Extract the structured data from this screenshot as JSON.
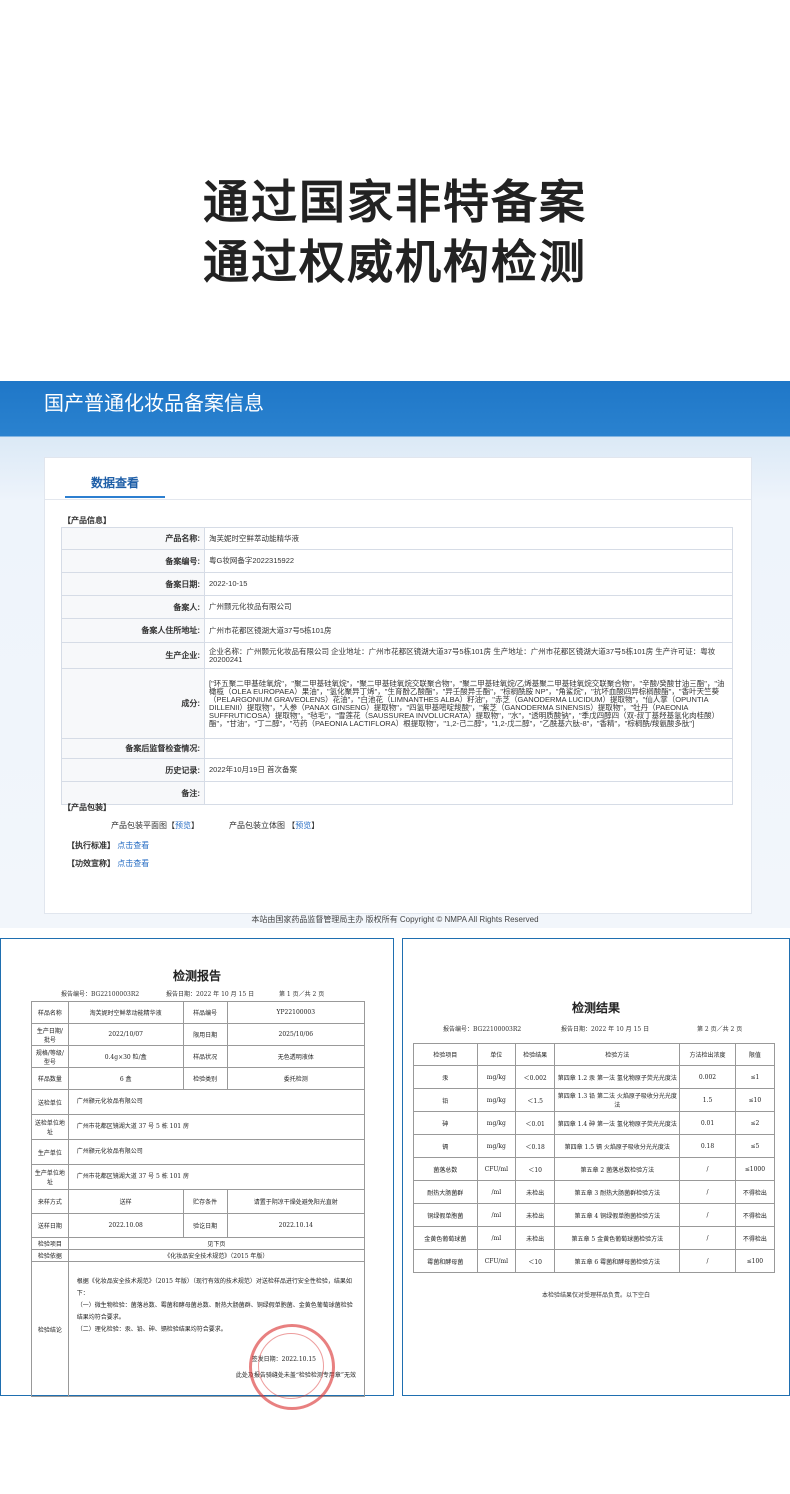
{
  "headline": {
    "line1": "通过国家非特备案",
    "line2": "通过权威机构检测"
  },
  "registration": {
    "title": "国产普通化妆品备案信息",
    "tab": "数据查看",
    "product_info_label": "【产品信息】",
    "rows": [
      {
        "k": "产品名称:",
        "v": "淘芙妮时空鲜萃动能精华液"
      },
      {
        "k": "备案编号:",
        "v": "粤G妆网备字2022315922"
      },
      {
        "k": "备案日期:",
        "v": "2022-10-15"
      },
      {
        "k": "备案人:",
        "v": "广州颢元化妆品有限公司"
      },
      {
        "k": "备案人住所地址:",
        "v": "广州市花都区镜湖大道37号5栋101房"
      },
      {
        "k": "生产企业:",
        "v": "企业名称：广州颢元化妆品有限公司 企业地址：广州市花都区镜湖大道37号5栋101房 生产地址：广州市花都区镜湖大道37号5栋101房 生产许可证：粤妆20200241"
      },
      {
        "k": "成分:",
        "v": "[\"环五聚二甲基硅氧烷\"，\"聚二甲基硅氧烷\"，\"聚二甲基硅氧烷交联聚合物\"，\"聚二甲基硅氧烷/乙烯基聚二甲基硅氧烷交联聚合物\"，\"辛酸/癸酸甘油三酯\"，\"油橄榄（OLEA EUROPAEA）果油\"，\"氢化聚异丁烯\"，\"生育酚乙酸酯\"，\"异壬酸异壬酯\"，\"棕榈酰胺 NP\"，\"角鲨烷\"，\"抗坏血酸四异棕榈酸酯\"，\"香叶天竺葵（PELARGONIUM GRAVEOLENS）花油\"，\"白池花（LIMNANTHES ALBA）籽油\"，\"赤芝（GANODERMA LUCIDUM）提取物\"，\"仙人掌（OPUNTIA DILLENII）提取物\"，\"人参（PANAX GINSENG）提取物\"，\"四氢甲基嘧啶羧酸\"，\"紫芝（GANODERMA SINENSIS）提取物\"，\"牡丹（PAEONIA SUFFRUTICOSA）提取物\"，\"毡毛\"，\"雪莲花（SAUSSUREA INVOLUCRATA）提取物\"，\"水\"，\"透明质酸钠\"，\"季戊四醇四（双-叔丁基羟基氢化肉桂酸）酯\"，\"甘油\"，\"丁二醇\"，\"芍药（PAEONIA LACTIFLORA）根提取物\"，\"1,2-己二醇\"，\"1,2-戊二醇\"，\"乙酰基六肽-8\"，\"香精\"，\"棕榈酰/羧氨酸多肽\"]"
      },
      {
        "k": "备案后监督检查情况:",
        "v": ""
      },
      {
        "k": "历史记录:",
        "v": "2022年10月19日 首次备案"
      },
      {
        "k": "备注:",
        "v": ""
      }
    ],
    "pkg_label": "【产品包装】",
    "pkg_flat": "产品包装平面图",
    "pkg_3d": "产品包装立体图",
    "preview": "预览",
    "bracket_l": "【",
    "bracket_r": "】",
    "standard_label": "【执行标准】",
    "efficacy_label": "【功效宣称】",
    "click_view": "点击查看",
    "footer": "本站由国家药品监督管理局主办 版权所有 Copyright © NMPA All Rights Reserved"
  },
  "report1": {
    "title": "检测报告",
    "report_no": "报告编号：BG22100003R2",
    "report_date": "报告日期：2022 年 10 月 15 日",
    "page": "第 1 页／共 2 页",
    "rows4": [
      [
        "样品名称",
        "淘芙妮时空鲜萃动能精华液",
        "样品编号",
        "YP22100003"
      ],
      [
        "生产日期/批号",
        "2022/10/07",
        "限用日期",
        "2025/10/06"
      ],
      [
        "规格/等级/型号",
        "0.4g×30 粒/盒",
        "样品状况",
        "无色透明液体"
      ],
      [
        "样品数量",
        "6 盒",
        "检验类别",
        "委托检测"
      ]
    ],
    "rows2": [
      [
        "送检单位",
        "广州颢元化妆品有限公司"
      ],
      [
        "送检单位地址",
        "广州市花都区镜湖大道 37 号 5 栋 101 房"
      ],
      [
        "生产单位",
        "广州颢元化妆品有限公司"
      ],
      [
        "生产单位地址",
        "广州市花都区镜湖大道 37 号 5 栋 101 房"
      ]
    ],
    "rows4b": [
      [
        "来样方式",
        "送样",
        "贮存条件",
        "请置于阴凉干燥处避免阳光直射"
      ],
      [
        "送样日期",
        "2022.10.08",
        "验讫日期",
        "2022.10.14"
      ]
    ],
    "item_k": "检验项目",
    "item_v": "见下页",
    "basis_k": "检验依据",
    "basis_v": "《化妆品安全技术规范》（2015 年版）",
    "conclusion_k": "检验结论",
    "conclusion_p1": "根据《化妆品安全技术规范》（2015 年版）（现行有效的技术规范）对送检样品进行安全性检验，结果如下：",
    "conclusion_p2": "（一）微生物检验：菌落总数、霉菌和酵母菌总数、耐热大肠菌群、铜绿假单胞菌、金黄色葡萄球菌检验结果均符合要求。",
    "conclusion_p3": "（二）理化检验：汞、铅、砷、镉检验结果均符合要求。",
    "sign_date": "签发日期：2022.10.15",
    "note": "此处及报告骑缝处未盖“检验检测专用章”无效"
  },
  "report2": {
    "title": "检测结果",
    "report_no": "报告编号：BG22100003R2",
    "report_date": "报告日期：2022 年 10 月 15 日",
    "page": "第 2 页／共 2 页",
    "headers": [
      "检验项目",
      "单位",
      "检验结果",
      "检验方法",
      "方法检出浓度",
      "限值"
    ],
    "rows": [
      [
        "汞",
        "mg/kg",
        "＜0.002",
        "第四章 1.2 汞 第一法 氢化物原子荧光光度法",
        "0.002",
        "≤1"
      ],
      [
        "铅",
        "mg/kg",
        "＜1.5",
        "第四章 1.3 铅 第二法 火焰原子吸收分光光度法",
        "1.5",
        "≤10"
      ],
      [
        "砷",
        "mg/kg",
        "＜0.01",
        "第四章 1.4 砷 第一法 氢化物原子荧光光度法",
        "0.01",
        "≤2"
      ],
      [
        "镉",
        "mg/kg",
        "＜0.18",
        "第四章 1.5 镉 火焰原子吸收分光光度法",
        "0.18",
        "≤5"
      ],
      [
        "菌落总数",
        "CFU/ml",
        "＜10",
        "第五章 2 菌落总数检验方法",
        "/",
        "≤1000"
      ],
      [
        "耐热大肠菌群",
        "/ml",
        "未检出",
        "第五章 3 耐热大肠菌群检验方法",
        "/",
        "不得检出"
      ],
      [
        "铜绿假单胞菌",
        "/ml",
        "未检出",
        "第五章 4 铜绿假单胞菌检验方法",
        "/",
        "不得检出"
      ],
      [
        "金黄色葡萄球菌",
        "/ml",
        "未检出",
        "第五章 5 金黄色葡萄球菌检验方法",
        "/",
        "不得检出"
      ],
      [
        "霉菌和酵母菌",
        "CFU/ml",
        "＜10",
        "第五章 6 霉菌和酵母菌检验方法",
        "/",
        "≤100"
      ]
    ],
    "note": "本检验结果仅对受理样品负责。以下空白"
  }
}
